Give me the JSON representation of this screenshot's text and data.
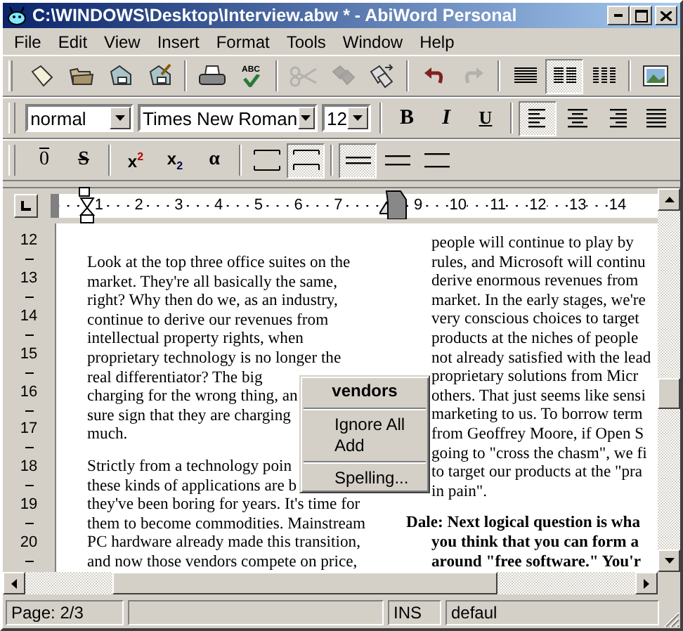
{
  "window": {
    "title": "C:\\WINDOWS\\Desktop\\Interview.abw * - AbiWord Personal"
  },
  "menu": [
    {
      "label": "File"
    },
    {
      "label": "Edit"
    },
    {
      "label": "View"
    },
    {
      "label": "Insert"
    },
    {
      "label": "Format"
    },
    {
      "label": "Tools"
    },
    {
      "label": "Window"
    },
    {
      "label": "Help"
    }
  ],
  "standard_toolbar": [
    [
      {
        "kind": "new",
        "disabled": false
      },
      {
        "kind": "open",
        "disabled": false
      },
      {
        "kind": "save",
        "disabled": false
      },
      {
        "kind": "save_as",
        "disabled": false
      }
    ],
    [
      {
        "kind": "print",
        "disabled": false
      },
      {
        "kind": "spell",
        "label": "ABC",
        "disabled": false
      }
    ],
    [
      {
        "kind": "cut",
        "disabled": true
      },
      {
        "kind": "copy",
        "disabled": true
      },
      {
        "kind": "paste",
        "disabled": false
      }
    ],
    [
      {
        "kind": "undo",
        "disabled": false
      },
      {
        "kind": "redo",
        "disabled": true
      }
    ],
    [
      {
        "kind": "columns_1",
        "disabled": false,
        "selected": false
      },
      {
        "kind": "columns_2",
        "disabled": false,
        "selected": true
      },
      {
        "kind": "columns_3",
        "disabled": false,
        "selected": false
      }
    ],
    [
      {
        "kind": "image",
        "disabled": false
      }
    ]
  ],
  "format_toolbar": {
    "style": {
      "value": "normal"
    },
    "font": {
      "value": "Times New Roman"
    },
    "size": {
      "value": "12"
    },
    "text_buttons": [
      {
        "kind": "bold",
        "label": "B",
        "selected": false
      },
      {
        "kind": "italic",
        "label": "I",
        "selected": false
      },
      {
        "kind": "underline",
        "label": "U",
        "selected": false
      }
    ],
    "align_buttons": [
      {
        "kind": "left",
        "selected": true
      },
      {
        "kind": "center",
        "selected": false
      },
      {
        "kind": "right",
        "selected": false
      },
      {
        "kind": "justify",
        "selected": false
      }
    ]
  },
  "extra_toolbar": {
    "text_buttons": [
      {
        "kind": "overline",
        "label": "0",
        "selected": false
      },
      {
        "kind": "strike",
        "label": "S",
        "selected": false
      }
    ],
    "script_buttons": [
      {
        "kind": "superscript",
        "label": "x$^{2}$",
        "selected": false
      },
      {
        "kind": "subscript",
        "label": "x$_{2}$",
        "selected": false
      },
      {
        "kind": "symbol",
        "label": "α",
        "selected": false
      }
    ],
    "spacing_buttons": [
      {
        "kind": "none",
        "selected": false
      },
      {
        "kind": "before",
        "selected": true
      }
    ],
    "line_spacing_buttons": [
      {
        "kind": "single",
        "selected": true
      },
      {
        "kind": "one_half",
        "selected": false
      },
      {
        "kind": "double",
        "selected": false
      }
    ]
  },
  "ruler": {
    "left_numbers": [
      "1",
      "2",
      "3",
      "4",
      "5",
      "6",
      "7"
    ],
    "right_numbers": [
      "9",
      "10",
      "11",
      "12",
      "13",
      "14"
    ]
  },
  "vertical_ruler": {
    "numbers": [
      "12",
      "13",
      "14",
      "15",
      "16",
      "17",
      "18",
      "19",
      "20"
    ]
  },
  "document": {
    "left_column": [
      {
        "kind": "body",
        "lines": [
          "Look at the top three office suites on the",
          "market. They're all basically the same,",
          "right? Why then do we, as an industry,",
          "continue to derive our revenues from",
          "intellectual property rights, when",
          "proprietary technology is no longer the",
          "real differentiator? The big",
          "charging for the wrong thing, an",
          "sure sign that they are charging",
          "much."
        ]
      },
      {
        "kind": "body",
        "lines": [
          "Strictly from a technology poin",
          "these kinds of applications are b",
          "they've been boring for years. It's time for",
          "them to become commodities. Mainstream",
          "PC hardware already made this transition,",
          "and now those vendors compete on price,"
        ]
      }
    ],
    "right_column": [
      {
        "kind": "body",
        "lines": [
          "people will continue to play by",
          "rules, and Microsoft will continu",
          "derive enormous revenues from",
          "market. In the early stages, we're",
          "very conscious choices to target",
          "products at the niches of people",
          "not already satisfied with the lead",
          "proprietary solutions from Micr",
          "others. That just seems like sensi",
          "marketing to us. To borrow term",
          "from Geoffrey Moore, if Open S",
          "going to \"cross the chasm\", we fi",
          "to target our products at the \"pra",
          "in pain\"."
        ]
      },
      {
        "kind": "speaker",
        "lines": [
          "Dale: Next logical question is wha",
          "you think that you can form a",
          "around \"free software.\" You'r"
        ]
      }
    ]
  },
  "context_menu": {
    "title": "vendors",
    "groups": [
      [
        {
          "label": "Ignore All"
        },
        {
          "label": "Add"
        }
      ],
      [
        {
          "label": "Spelling..."
        }
      ]
    ]
  },
  "status_bar": {
    "page": "Page: 2/3",
    "mode": "INS",
    "language": "defaul"
  }
}
